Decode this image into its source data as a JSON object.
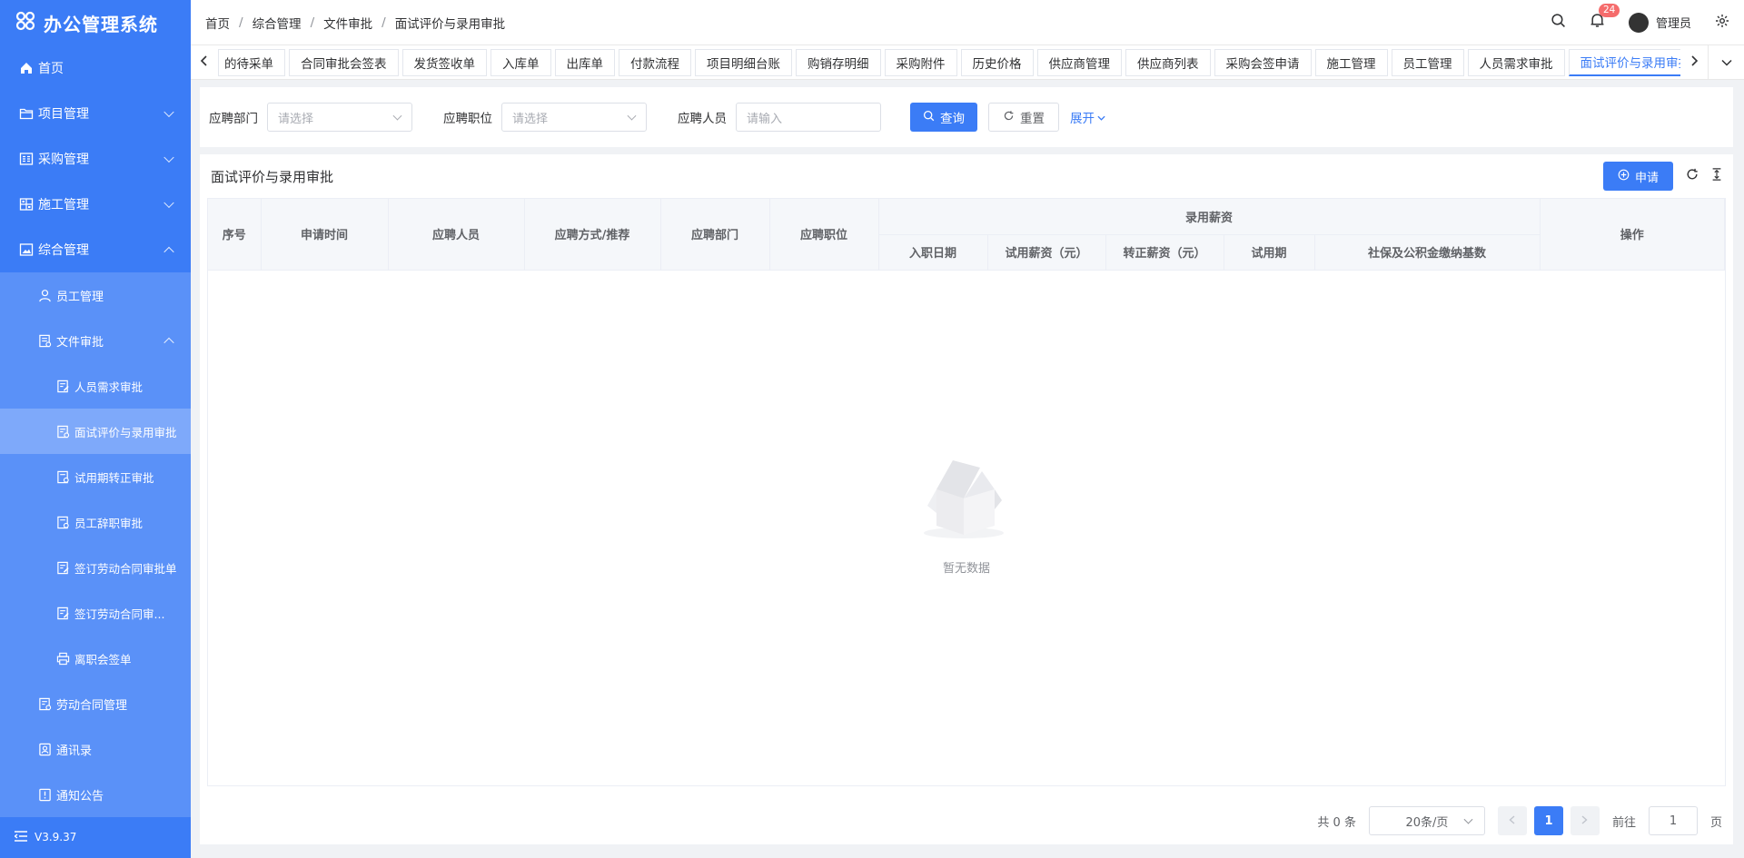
{
  "app": {
    "title": "办公管理系统",
    "version": "V3.9.37"
  },
  "sidebar": {
    "items": [
      {
        "label": "首页",
        "icon": "home-icon"
      },
      {
        "label": "项目管理",
        "icon": "folder-icon"
      },
      {
        "label": "采购管理",
        "icon": "list-icon"
      },
      {
        "label": "施工管理",
        "icon": "grid-icon"
      },
      {
        "label": "综合管理",
        "icon": "picture-icon"
      }
    ],
    "sub": {
      "employee": "员工管理",
      "doc_approval": "文件审批",
      "doc_children": [
        "人员需求审批",
        "面试评价与录用审批",
        "试用期转正审批",
        "员工辞职审批",
        "签订劳动合同审批单",
        "签订劳动合同审...",
        "离职会签单"
      ],
      "labor_contract": "劳动合同管理",
      "contacts": "通讯录",
      "notice": "通知公告"
    }
  },
  "header": {
    "breadcrumb": [
      "首页",
      "综合管理",
      "文件审批",
      "面试评价与录用审批"
    ],
    "notifications": "24",
    "user": "管理员"
  },
  "tabs": [
    "的待采单",
    "合同审批会签表",
    "发货签收单",
    "入库单",
    "出库单",
    "付款流程",
    "项目明细台账",
    "购销存明细",
    "采购附件",
    "历史价格",
    "供应商管理",
    "供应商列表",
    "采购会签申请",
    "施工管理",
    "员工管理",
    "人员需求审批",
    "面试评价与录用审批"
  ],
  "filter": {
    "dept_label": "应聘部门",
    "dept_placeholder": "请选择",
    "position_label": "应聘职位",
    "position_placeholder": "请选择",
    "person_label": "应聘人员",
    "person_placeholder": "请输入",
    "query": "查询",
    "reset": "重置",
    "expand": "展开"
  },
  "panel": {
    "title": "面试评价与录用审批",
    "apply": "申请"
  },
  "table": {
    "columns": [
      "序号",
      "申请时间",
      "应聘人员",
      "应聘方式/推荐",
      "应聘部门",
      "应聘职位"
    ],
    "group": "录用薪资",
    "group_columns": [
      "入职日期",
      "试用薪资（元）",
      "转正薪资（元）",
      "试用期",
      "社保及公积金缴纳基数"
    ],
    "action": "操作",
    "empty": "暂无数据"
  },
  "pager": {
    "total": "共 0 条",
    "page_size": "20条/页",
    "current": "1",
    "goto_label": "前往",
    "goto_value": "1",
    "page_suffix": "页"
  }
}
